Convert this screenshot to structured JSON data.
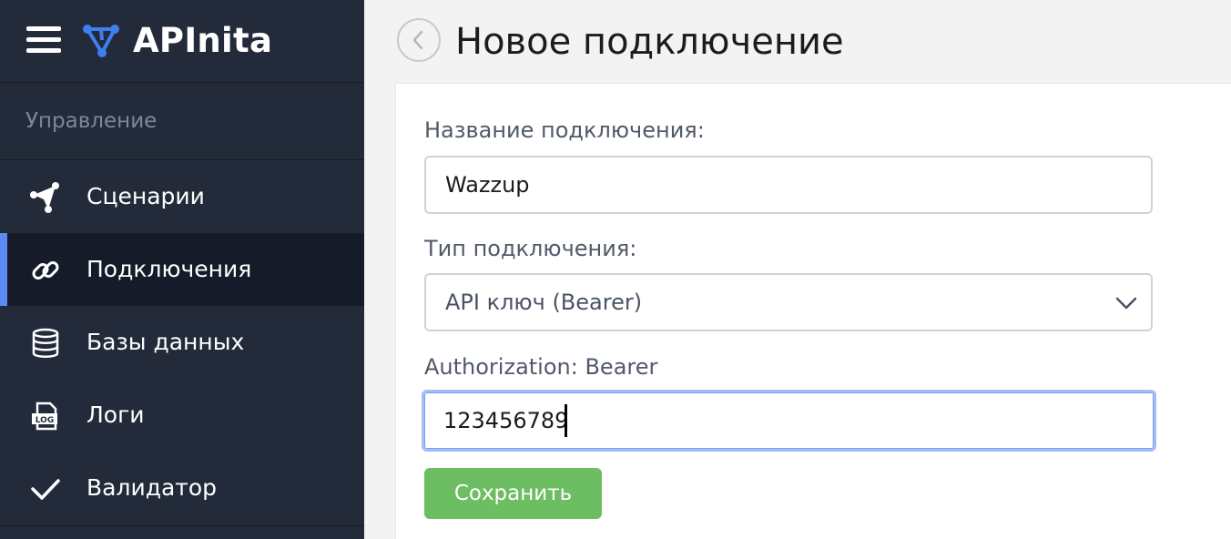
{
  "app": {
    "name": "APInita"
  },
  "sidebar": {
    "section_title": "Управление",
    "items": [
      {
        "label": "Сценарии",
        "icon": "send-nodes-icon",
        "active": false
      },
      {
        "label": "Подключения",
        "icon": "link-icon",
        "active": true
      },
      {
        "label": "Базы данных",
        "icon": "database-icon",
        "active": false
      },
      {
        "label": "Логи",
        "icon": "log-file-icon",
        "active": false
      },
      {
        "label": "Валидатор",
        "icon": "checkmark-icon",
        "active": false
      }
    ],
    "log_icon_text": "LOG"
  },
  "page": {
    "title": "Новое подключение"
  },
  "form": {
    "name_label": "Название подключения:",
    "name_value": "Wazzup",
    "type_label": "Тип подключения:",
    "type_value": "API ключ (Bearer)",
    "auth_label": "Authorization: Bearer",
    "auth_value": "123456789",
    "save_label": "Сохранить"
  },
  "colors": {
    "sidebar_bg": "#232b3b",
    "sidebar_active_bg": "#151b28",
    "active_accent": "#5b8bf0",
    "brand_icon": "#3f7ef0",
    "save_button": "#6dbd63",
    "focus_ring": "#a4bdf5"
  }
}
